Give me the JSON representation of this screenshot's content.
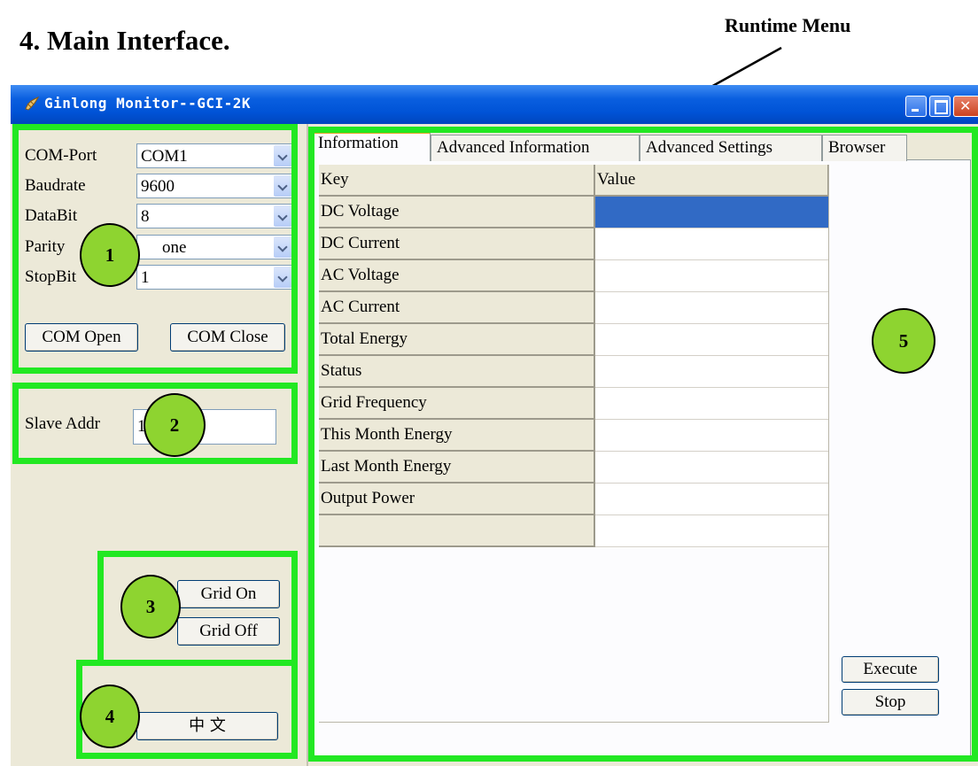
{
  "doc": {
    "heading": "4.  Main Interface.",
    "runtime_label": "Runtime Menu"
  },
  "window": {
    "title": "Ginlong Monitor--GCI-2K"
  },
  "com_settings": {
    "rows": [
      {
        "label": "COM-Port",
        "value": "COM1"
      },
      {
        "label": "Baudrate",
        "value": "9600"
      },
      {
        "label": "DataBit",
        "value": "8"
      },
      {
        "label": "Parity",
        "value": "one"
      },
      {
        "label": "StopBit",
        "value": "1"
      }
    ],
    "open_label": "COM Open",
    "close_label": "COM Close"
  },
  "slave": {
    "label": "Slave Addr",
    "value": "1"
  },
  "grid_controls": {
    "on_label": "Grid On",
    "off_label": "Grid Off"
  },
  "language": {
    "label": "中  文"
  },
  "tabs": [
    "Information",
    "Advanced Information",
    "Advanced Settings",
    "Browser"
  ],
  "table": {
    "headers": [
      "Key",
      "Value"
    ],
    "rows": [
      {
        "key": "DC Voltage",
        "value": ""
      },
      {
        "key": "DC Current",
        "value": ""
      },
      {
        "key": "AC Voltage",
        "value": ""
      },
      {
        "key": "AC Current",
        "value": ""
      },
      {
        "key": "Total Energy",
        "value": ""
      },
      {
        "key": "Status",
        "value": ""
      },
      {
        "key": "Grid Frequency",
        "value": ""
      },
      {
        "key": "This Month Energy",
        "value": ""
      },
      {
        "key": "Last Month Energy",
        "value": ""
      },
      {
        "key": "Output Power",
        "value": ""
      },
      {
        "key": "",
        "value": ""
      }
    ]
  },
  "actions": {
    "execute_label": "Execute",
    "stop_label": "Stop"
  },
  "callouts": [
    "1",
    "2",
    "3",
    "4",
    "5"
  ],
  "colors": {
    "highlight_box": "#22e822",
    "callout_fill": "#8ed430",
    "title_bar": "#0053d6",
    "selection": "#316ac5"
  }
}
